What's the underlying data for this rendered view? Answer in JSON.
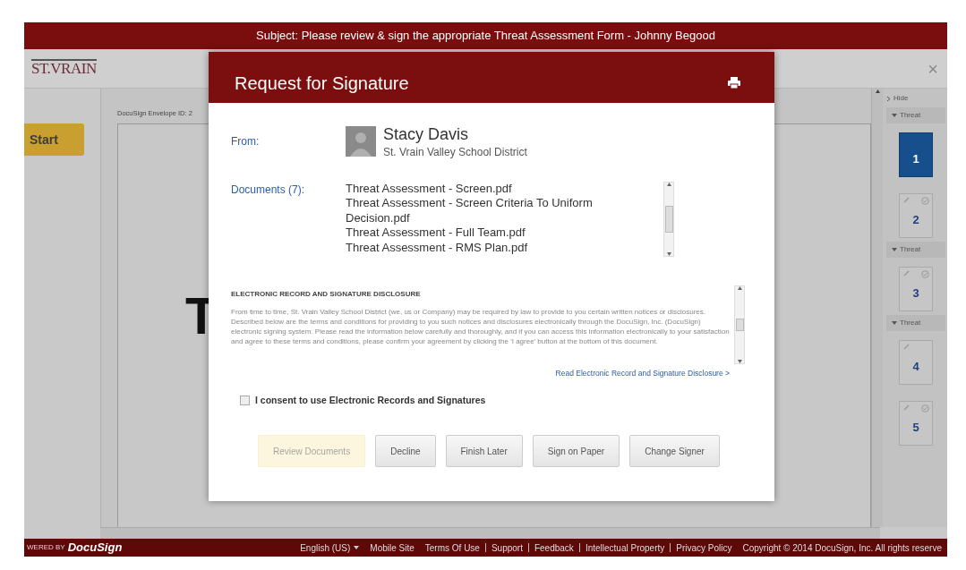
{
  "subject_bar": {
    "text": "Subject: Please review & sign the appropriate Threat Assessment Form - Johnny Begood"
  },
  "header": {
    "logo": "ST.VRAIN",
    "close": "×"
  },
  "start_button": {
    "label": "Start"
  },
  "document": {
    "envelope_id": "DocuSign Envelope ID: 2",
    "big_letter": "T"
  },
  "sidebar": {
    "hide": "Hide",
    "groups": [
      {
        "label": "Threat",
        "expanded": true,
        "pages": [
          {
            "number": "1",
            "selected": true,
            "has_check": false
          },
          {
            "number": "2",
            "selected": false,
            "has_check": true
          }
        ]
      },
      {
        "label": "Threat",
        "expanded": true,
        "pages": [
          {
            "number": "3",
            "selected": false,
            "has_check": true
          }
        ]
      },
      {
        "label": "Threat",
        "expanded": true,
        "pages": [
          {
            "number": "4",
            "selected": false,
            "has_check": false
          },
          {
            "number": "5",
            "selected": false,
            "has_check": true
          }
        ]
      }
    ]
  },
  "modal": {
    "title": "Request for Signature",
    "from_label": "From:",
    "sender": {
      "name": "Stacy Davis",
      "organization": "St. Vrain Valley School District"
    },
    "documents_label": "Documents (7):",
    "documents": [
      "Threat Assessment - Screen.pdf",
      "Threat Assessment - Screen Criteria To Uniform Decision.pdf",
      "Threat Assessment - Full Team.pdf",
      "Threat Assessment - RMS Plan.pdf"
    ],
    "disclosure": {
      "heading": "ELECTRONIC RECORD AND SIGNATURE DISCLOSURE",
      "text": "From time to time, St. Vrain Valley School District (we, us or Company) may be required by law to provide to you certain written notices or disclosures. Described below are the terms and conditions for providing to you such notices and disclosures electronically through the DocuSign, Inc. (DocuSign) electronic signing system. Please read the information below carefully and thoroughly, and if you can access this information electronically to your satisfaction and agree to these terms and conditions, please confirm your agreement by clicking the 'I agree' button at the bottom of this document.",
      "link": "Read Electronic Record and Signature Disclosure >"
    },
    "consent": {
      "label": "I consent to use Electronic Records and Signatures",
      "checked": false
    },
    "buttons": [
      {
        "label": "Review Documents",
        "kind": "primary",
        "disabled": true
      },
      {
        "label": "Decline",
        "kind": "secondary",
        "disabled": false
      },
      {
        "label": "Finish Later",
        "kind": "secondary",
        "disabled": false
      },
      {
        "label": "Sign on Paper",
        "kind": "secondary",
        "disabled": false
      },
      {
        "label": "Change Signer",
        "kind": "secondary",
        "disabled": false
      }
    ]
  },
  "footer": {
    "powered_by": "WERED BY",
    "brand": "DocuSign",
    "language": "English (US)",
    "links": [
      "Mobile Site",
      "Terms Of Use",
      "Support",
      "Feedback",
      "Intellectual Property",
      "Privacy Policy"
    ],
    "copyright": "Copyright © 2014 DocuSign, Inc. All rights reserve"
  }
}
